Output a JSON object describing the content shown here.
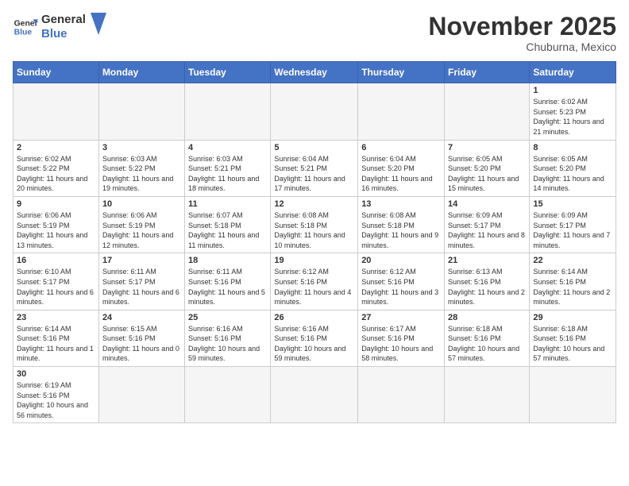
{
  "header": {
    "logo_general": "General",
    "logo_blue": "Blue",
    "month_title": "November 2025",
    "location": "Chuburna, Mexico"
  },
  "days_of_week": [
    "Sunday",
    "Monday",
    "Tuesday",
    "Wednesday",
    "Thursday",
    "Friday",
    "Saturday"
  ],
  "weeks": [
    [
      {
        "day": "",
        "info": ""
      },
      {
        "day": "",
        "info": ""
      },
      {
        "day": "",
        "info": ""
      },
      {
        "day": "",
        "info": ""
      },
      {
        "day": "",
        "info": ""
      },
      {
        "day": "",
        "info": ""
      },
      {
        "day": "1",
        "info": "Sunrise: 6:02 AM\nSunset: 5:23 PM\nDaylight: 11 hours and 21 minutes."
      }
    ],
    [
      {
        "day": "2",
        "info": "Sunrise: 6:02 AM\nSunset: 5:22 PM\nDaylight: 11 hours and 20 minutes."
      },
      {
        "day": "3",
        "info": "Sunrise: 6:03 AM\nSunset: 5:22 PM\nDaylight: 11 hours and 19 minutes."
      },
      {
        "day": "4",
        "info": "Sunrise: 6:03 AM\nSunset: 5:21 PM\nDaylight: 11 hours and 18 minutes."
      },
      {
        "day": "5",
        "info": "Sunrise: 6:04 AM\nSunset: 5:21 PM\nDaylight: 11 hours and 17 minutes."
      },
      {
        "day": "6",
        "info": "Sunrise: 6:04 AM\nSunset: 5:20 PM\nDaylight: 11 hours and 16 minutes."
      },
      {
        "day": "7",
        "info": "Sunrise: 6:05 AM\nSunset: 5:20 PM\nDaylight: 11 hours and 15 minutes."
      },
      {
        "day": "8",
        "info": "Sunrise: 6:05 AM\nSunset: 5:20 PM\nDaylight: 11 hours and 14 minutes."
      }
    ],
    [
      {
        "day": "9",
        "info": "Sunrise: 6:06 AM\nSunset: 5:19 PM\nDaylight: 11 hours and 13 minutes."
      },
      {
        "day": "10",
        "info": "Sunrise: 6:06 AM\nSunset: 5:19 PM\nDaylight: 11 hours and 12 minutes."
      },
      {
        "day": "11",
        "info": "Sunrise: 6:07 AM\nSunset: 5:18 PM\nDaylight: 11 hours and 11 minutes."
      },
      {
        "day": "12",
        "info": "Sunrise: 6:08 AM\nSunset: 5:18 PM\nDaylight: 11 hours and 10 minutes."
      },
      {
        "day": "13",
        "info": "Sunrise: 6:08 AM\nSunset: 5:18 PM\nDaylight: 11 hours and 9 minutes."
      },
      {
        "day": "14",
        "info": "Sunrise: 6:09 AM\nSunset: 5:17 PM\nDaylight: 11 hours and 8 minutes."
      },
      {
        "day": "15",
        "info": "Sunrise: 6:09 AM\nSunset: 5:17 PM\nDaylight: 11 hours and 7 minutes."
      }
    ],
    [
      {
        "day": "16",
        "info": "Sunrise: 6:10 AM\nSunset: 5:17 PM\nDaylight: 11 hours and 6 minutes."
      },
      {
        "day": "17",
        "info": "Sunrise: 6:11 AM\nSunset: 5:17 PM\nDaylight: 11 hours and 6 minutes."
      },
      {
        "day": "18",
        "info": "Sunrise: 6:11 AM\nSunset: 5:16 PM\nDaylight: 11 hours and 5 minutes."
      },
      {
        "day": "19",
        "info": "Sunrise: 6:12 AM\nSunset: 5:16 PM\nDaylight: 11 hours and 4 minutes."
      },
      {
        "day": "20",
        "info": "Sunrise: 6:12 AM\nSunset: 5:16 PM\nDaylight: 11 hours and 3 minutes."
      },
      {
        "day": "21",
        "info": "Sunrise: 6:13 AM\nSunset: 5:16 PM\nDaylight: 11 hours and 2 minutes."
      },
      {
        "day": "22",
        "info": "Sunrise: 6:14 AM\nSunset: 5:16 PM\nDaylight: 11 hours and 2 minutes."
      }
    ],
    [
      {
        "day": "23",
        "info": "Sunrise: 6:14 AM\nSunset: 5:16 PM\nDaylight: 11 hours and 1 minute."
      },
      {
        "day": "24",
        "info": "Sunrise: 6:15 AM\nSunset: 5:16 PM\nDaylight: 11 hours and 0 minutes."
      },
      {
        "day": "25",
        "info": "Sunrise: 6:16 AM\nSunset: 5:16 PM\nDaylight: 10 hours and 59 minutes."
      },
      {
        "day": "26",
        "info": "Sunrise: 6:16 AM\nSunset: 5:16 PM\nDaylight: 10 hours and 59 minutes."
      },
      {
        "day": "27",
        "info": "Sunrise: 6:17 AM\nSunset: 5:16 PM\nDaylight: 10 hours and 58 minutes."
      },
      {
        "day": "28",
        "info": "Sunrise: 6:18 AM\nSunset: 5:16 PM\nDaylight: 10 hours and 57 minutes."
      },
      {
        "day": "29",
        "info": "Sunrise: 6:18 AM\nSunset: 5:16 PM\nDaylight: 10 hours and 57 minutes."
      }
    ],
    [
      {
        "day": "30",
        "info": "Sunrise: 6:19 AM\nSunset: 5:16 PM\nDaylight: 10 hours and 56 minutes."
      },
      {
        "day": "",
        "info": ""
      },
      {
        "day": "",
        "info": ""
      },
      {
        "day": "",
        "info": ""
      },
      {
        "day": "",
        "info": ""
      },
      {
        "day": "",
        "info": ""
      },
      {
        "day": "",
        "info": ""
      }
    ]
  ]
}
